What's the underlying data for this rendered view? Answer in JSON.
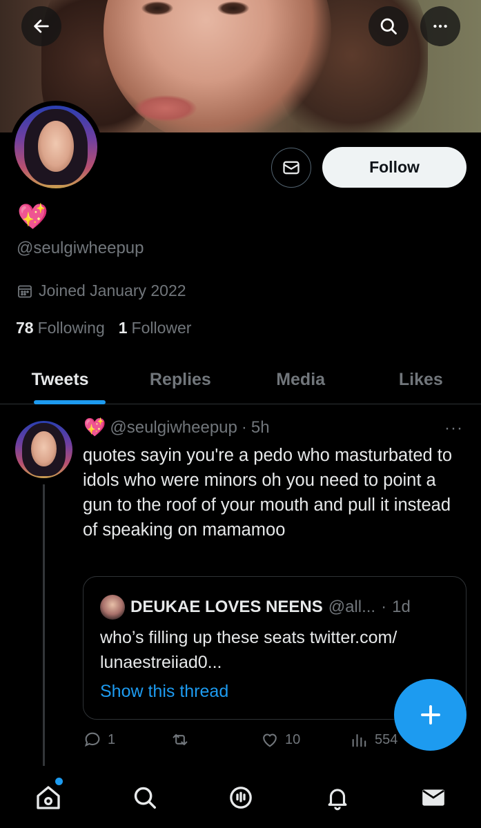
{
  "header": {
    "back_icon": "arrow-left-icon",
    "search_icon": "search-icon",
    "more_icon": "more-horizontal-icon"
  },
  "profile": {
    "display_name": "💖",
    "handle": "@seulgiwheepup",
    "joined": "Joined January 2022",
    "following_count": "78",
    "following_label": "Following",
    "followers_count": "1",
    "followers_label": "Follower",
    "follow_button": "Follow",
    "message_icon": "envelope-icon"
  },
  "tabs": [
    {
      "label": "Tweets",
      "active": true
    },
    {
      "label": "Replies",
      "active": false
    },
    {
      "label": "Media",
      "active": false
    },
    {
      "label": "Likes",
      "active": false
    }
  ],
  "tweet": {
    "name_emoji": "💖",
    "handle": "@seulgiwheepup",
    "separator": "·",
    "time": "5h",
    "more": "···",
    "text": "quotes sayin you're a pedo who masturbated to idols who were minors oh you need to point a gun to the roof of your mouth and pull it instead of speaking on mamamoo",
    "quote": {
      "name": "DEUKAE LOVES NEENS",
      "handle": "@all...",
      "separator": "·",
      "time": "1d",
      "text": "who’s filling up these seats twitter.com/ lunaestreiiad0...",
      "link": "Show this thread"
    },
    "actions": {
      "replies": "1",
      "retweets": "",
      "likes": "10",
      "views": "554"
    }
  },
  "fab": {
    "icon": "plus-icon"
  },
  "bottom_nav": [
    "home-icon",
    "search-icon",
    "spaces-icon",
    "notifications-icon",
    "messages-icon"
  ],
  "colors": {
    "accent": "#1d9bf0",
    "background": "#000000",
    "muted": "#71767b"
  }
}
